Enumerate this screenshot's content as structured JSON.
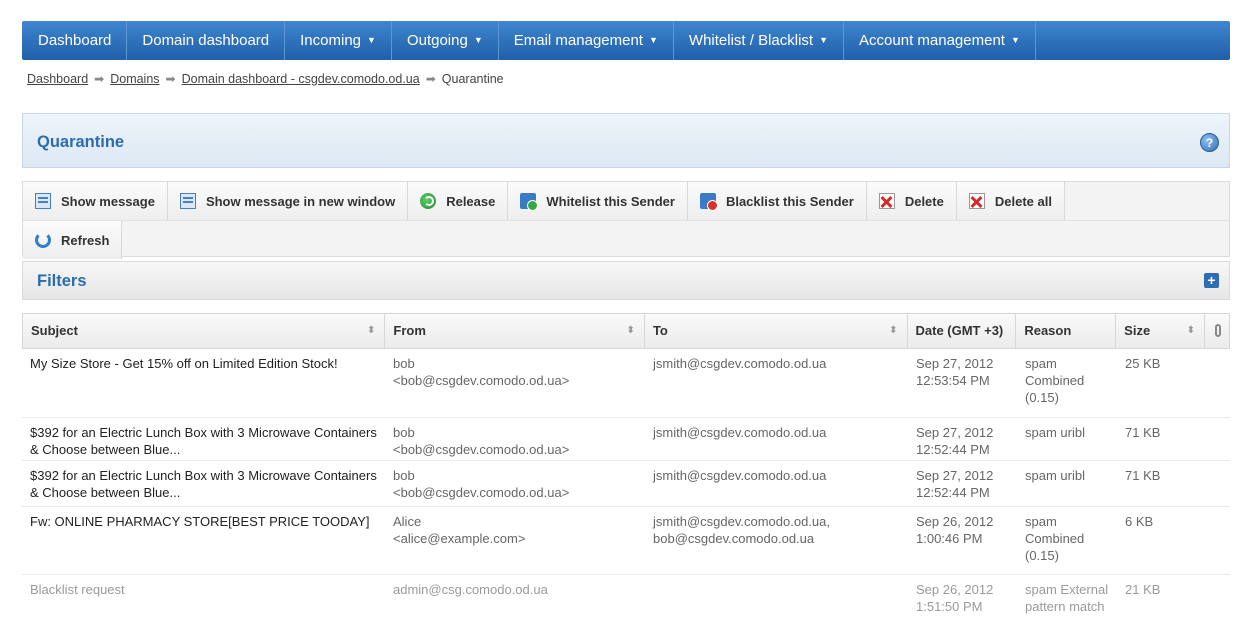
{
  "nav": [
    {
      "label": "Dashboard",
      "dropdown": false
    },
    {
      "label": "Domain dashboard",
      "dropdown": false
    },
    {
      "label": "Incoming",
      "dropdown": true
    },
    {
      "label": "Outgoing",
      "dropdown": true
    },
    {
      "label": "Email management",
      "dropdown": true
    },
    {
      "label": "Whitelist / Blacklist",
      "dropdown": true
    },
    {
      "label": "Account management",
      "dropdown": true
    }
  ],
  "breadcrumb": {
    "items": [
      "Dashboard",
      "Domains",
      "Domain dashboard - csgdev.comodo.od.ua"
    ],
    "current": "Quarantine"
  },
  "panel": {
    "title": "Quarantine"
  },
  "toolbar": {
    "show_message": "Show message",
    "show_new_window": "Show message in new window",
    "release": "Release",
    "whitelist_sender": "Whitelist this Sender",
    "blacklist_sender": "Blacklist this Sender",
    "delete": "Delete",
    "delete_all": "Delete all",
    "refresh": "Refresh"
  },
  "filters": {
    "title": "Filters"
  },
  "table": {
    "headers": {
      "subject": "Subject",
      "from": "From",
      "to": "To",
      "date": "Date (GMT +3)",
      "reason": "Reason",
      "size": "Size"
    },
    "rows": [
      {
        "subject": "My Size Store - Get 15% off on Limited Edition Stock!",
        "from_name": "bob",
        "from_email": "<bob@csgdev.comodo.od.ua>",
        "to": "jsmith@csgdev.comodo.od.ua",
        "date": "Sep 27, 2012",
        "time": "12:53:54 PM",
        "reason": "spam Combined (0.15)",
        "size": "25 KB"
      },
      {
        "subject": "$392 for an Electric Lunch Box with 3 Microwave Containers & Choose between Blue...",
        "from_name": "bob",
        "from_email": "<bob@csgdev.comodo.od.ua>",
        "to": "jsmith@csgdev.comodo.od.ua",
        "date": "Sep 27, 2012",
        "time": "12:52:44 PM",
        "reason": "spam uribl",
        "size": "71 KB"
      },
      {
        "subject": "$392 for an Electric Lunch Box with 3 Microwave Containers & Choose between Blue...",
        "from_name": "bob",
        "from_email": "<bob@csgdev.comodo.od.ua>",
        "to": "jsmith@csgdev.comodo.od.ua",
        "date": "Sep 27, 2012",
        "time": "12:52:44 PM",
        "reason": "spam uribl",
        "size": "71 KB"
      },
      {
        "subject": "Fw: ONLINE PHARMACY STORE[BEST PRICE TOODAY]",
        "from_name": "Alice",
        "from_email": "<alice@example.com>",
        "to": "jsmith@csgdev.comodo.od.ua, bob@csgdev.comodo.od.ua",
        "date": "Sep 26, 2012",
        "time": "1:00:46 PM",
        "reason": "spam Combined (0.15)",
        "size": "6 KB"
      },
      {
        "subject": "Blacklist request",
        "from_name": "admin@csg.comodo.od.ua",
        "from_email": "",
        "to": "",
        "date": "Sep 26, 2012",
        "time": "1:51:50 PM",
        "reason": "spam External pattern match",
        "size": "21 KB"
      }
    ]
  },
  "colors": {
    "nav_bg": "#2a6bb5",
    "title_blue": "#2b6cb0"
  }
}
